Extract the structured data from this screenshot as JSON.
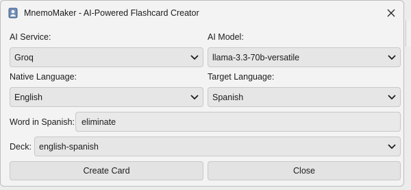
{
  "window": {
    "title": "MnemoMaker - AI-Powered Flashcard Creator"
  },
  "icons": {
    "app": "app-icon",
    "close": "close-icon",
    "chevron": "chevron-down-icon"
  },
  "fields": {
    "ai_service": {
      "label": "AI Service:",
      "value": "Groq"
    },
    "ai_model": {
      "label": "AI Model:",
      "value": "llama-3.3-70b-versatile"
    },
    "native_language": {
      "label": "Native Language:",
      "value": "English"
    },
    "target_language": {
      "label": "Target Language:",
      "value": "Spanish"
    },
    "word": {
      "label": "Word in Spanish:",
      "value": "eliminate"
    },
    "deck": {
      "label": "Deck:",
      "value": "english-spanish"
    }
  },
  "buttons": {
    "create": "Create Card",
    "close": "Close"
  }
}
